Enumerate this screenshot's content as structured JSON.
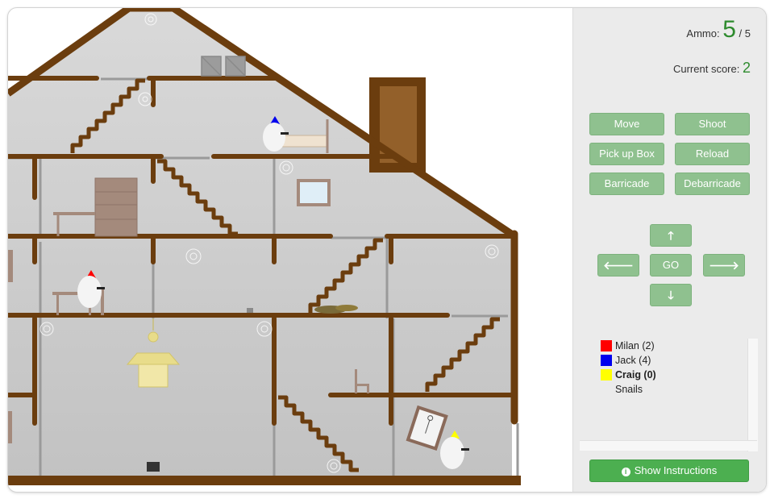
{
  "stats": {
    "ammo_label": "Ammo:",
    "ammo_value": "5",
    "ammo_max": "/ 5",
    "score_label": "Current score:",
    "score_value": "2"
  },
  "actions": {
    "move": "Move",
    "shoot": "Shoot",
    "pickup": "Pick up Box",
    "reload": "Reload",
    "barricade": "Barricade",
    "debarricade": "Debarricade"
  },
  "dpad": {
    "up": "🡑",
    "left": "🡐",
    "go": "GO",
    "right": "🡒",
    "down": "🡓"
  },
  "players": [
    {
      "name": "Milan (2)",
      "color": "#ff0000",
      "current": false
    },
    {
      "name": "Jack (4)",
      "color": "#0000ee",
      "current": false
    },
    {
      "name": "Craig (0)",
      "color": "#ffff00",
      "current": true
    },
    {
      "name": "Snails",
      "color": "",
      "current": false
    }
  ],
  "instructions_button": "Show Instructions",
  "colors": {
    "wood": "#6b3d0e",
    "wall": "#cfcfcf",
    "accent_green": "#2e8b2e",
    "button_green": "#8fc18f"
  }
}
